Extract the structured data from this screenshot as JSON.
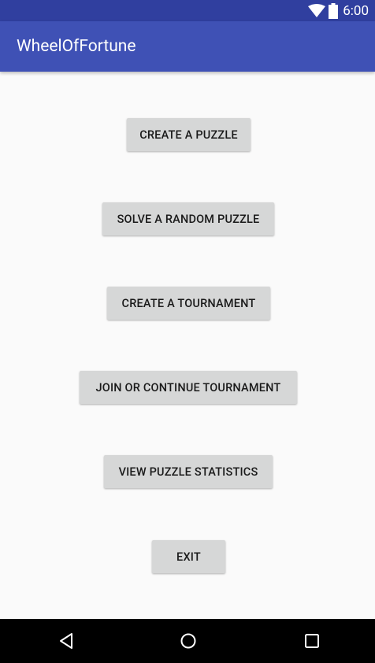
{
  "status_bar": {
    "time": "6:00",
    "icons": [
      "wifi-icon",
      "battery-icon"
    ]
  },
  "app_bar": {
    "title": "WheelOfFortune"
  },
  "buttons": {
    "create_puzzle": "CREATE A PUZZLE",
    "solve_random": "SOLVE A RANDOM PUZZLE",
    "create_tournament": "CREATE A TOURNAMENT",
    "join_tournament": "JOIN OR CONTINUE TOURNAMENT",
    "view_stats": "VIEW PUZZLE STATISTICS",
    "exit": "EXIT"
  },
  "nav_bar": {
    "icons": [
      "back-icon",
      "home-icon",
      "recents-icon"
    ]
  },
  "colors": {
    "primary": "#3f51b5",
    "primary_dark": "#303f9f",
    "background": "#fafafa",
    "button": "#d6d7d7"
  }
}
